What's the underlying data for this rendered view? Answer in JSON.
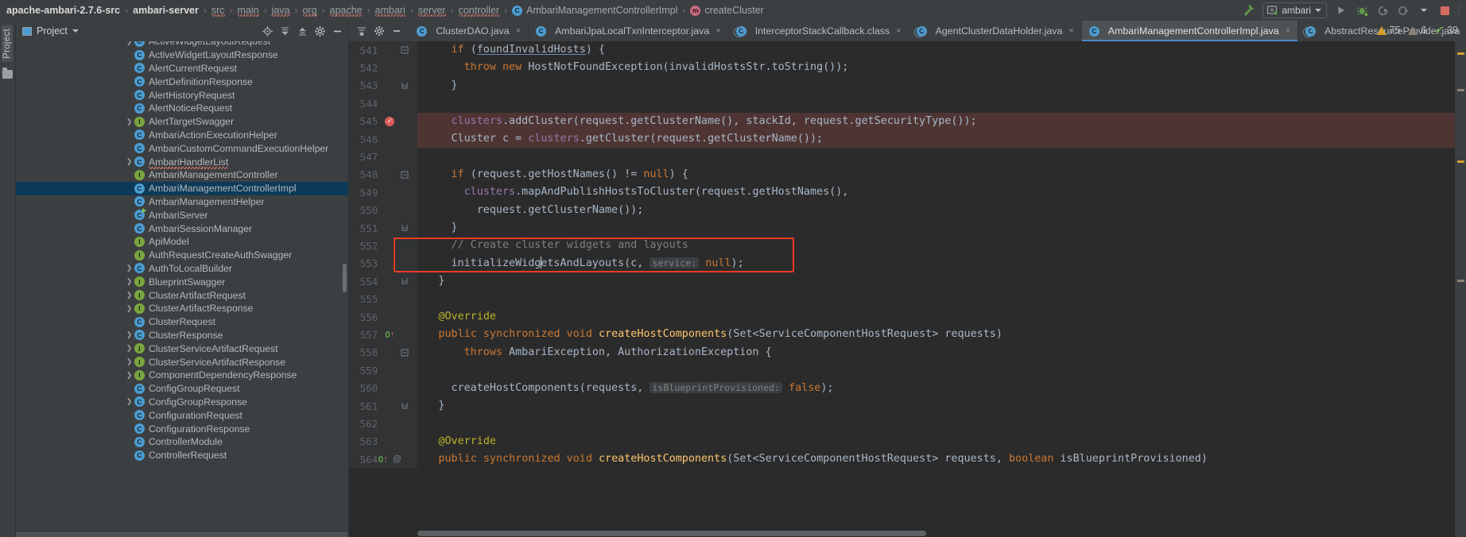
{
  "breadcrumb": {
    "items": [
      {
        "label": "apache-ambari-2.7.6-src",
        "style": "bold"
      },
      {
        "label": "ambari-server",
        "style": "bold"
      },
      {
        "label": "src",
        "style": "wavy"
      },
      {
        "label": "main",
        "style": "wavy"
      },
      {
        "label": "java",
        "style": "wavy"
      },
      {
        "label": "org",
        "style": "wavy"
      },
      {
        "label": "apache",
        "style": "wavy"
      },
      {
        "label": "ambari",
        "style": "wavy"
      },
      {
        "label": "server",
        "style": "wavy"
      },
      {
        "label": "controller",
        "style": "wavy"
      },
      {
        "label": "AmbariManagementControllerImpl",
        "style": "class"
      },
      {
        "label": "createCluster",
        "style": "method"
      }
    ],
    "separator": "›"
  },
  "toolbar": {
    "build_icon": "hammer-icon",
    "run_config": "ambari",
    "run_icon": "run-icon",
    "debug_icon": "debug-icon",
    "rerun_icon": "rerun-icon",
    "profile_icon": "profile-icon",
    "stop_icon": "stop-icon",
    "dropdown_caret": "▾"
  },
  "sidebar": {
    "vertical_tab": "Project",
    "title": "Project",
    "caret": "▾",
    "actions": [
      "locate-icon",
      "collapse-all-icon",
      "expand-icon",
      "settings-icon",
      "hide-icon"
    ],
    "tree": [
      {
        "label": "ActiveWidgetLayoutRequest",
        "icon": "class",
        "arrow": true,
        "partial": true
      },
      {
        "label": "ActiveWidgetLayoutResponse",
        "icon": "class",
        "arrow": false
      },
      {
        "label": "AlertCurrentRequest",
        "icon": "class",
        "arrow": false
      },
      {
        "label": "AlertDefinitionResponse",
        "icon": "class",
        "arrow": false
      },
      {
        "label": "AlertHistoryRequest",
        "icon": "class",
        "arrow": false
      },
      {
        "label": "AlertNoticeRequest",
        "icon": "class",
        "arrow": false
      },
      {
        "label": "AlertTargetSwagger",
        "icon": "interface",
        "arrow": true
      },
      {
        "label": "AmbariActionExecutionHelper",
        "icon": "class",
        "arrow": false
      },
      {
        "label": "AmbariCustomCommandExecutionHelper",
        "icon": "class",
        "arrow": false
      },
      {
        "label": "AmbariHandlerList",
        "icon": "class",
        "arrow": true,
        "wavy": true
      },
      {
        "label": "AmbariManagementController",
        "icon": "interface",
        "arrow": false
      },
      {
        "label": "AmbariManagementControllerImpl",
        "icon": "class",
        "arrow": false,
        "selected": true
      },
      {
        "label": "AmbariManagementHelper",
        "icon": "class",
        "arrow": false
      },
      {
        "label": "AmbariServer",
        "icon": "class",
        "arrow": false,
        "runnable": true
      },
      {
        "label": "AmbariSessionManager",
        "icon": "class",
        "arrow": false
      },
      {
        "label": "ApiModel",
        "icon": "interface",
        "arrow": false
      },
      {
        "label": "AuthRequestCreateAuthSwagger",
        "icon": "interface",
        "arrow": false
      },
      {
        "label": "AuthToLocalBuilder",
        "icon": "class",
        "arrow": true
      },
      {
        "label": "BlueprintSwagger",
        "icon": "interface",
        "arrow": true
      },
      {
        "label": "ClusterArtifactRequest",
        "icon": "interface",
        "arrow": true
      },
      {
        "label": "ClusterArtifactResponse",
        "icon": "interface",
        "arrow": true
      },
      {
        "label": "ClusterRequest",
        "icon": "class",
        "arrow": false
      },
      {
        "label": "ClusterResponse",
        "icon": "class",
        "arrow": true
      },
      {
        "label": "ClusterServiceArtifactRequest",
        "icon": "interface",
        "arrow": true
      },
      {
        "label": "ClusterServiceArtifactResponse",
        "icon": "interface",
        "arrow": true
      },
      {
        "label": "ComponentDependencyResponse",
        "icon": "interface",
        "arrow": true
      },
      {
        "label": "ConfigGroupRequest",
        "icon": "class",
        "arrow": false
      },
      {
        "label": "ConfigGroupResponse",
        "icon": "class",
        "arrow": true
      },
      {
        "label": "ConfigurationRequest",
        "icon": "class",
        "arrow": false
      },
      {
        "label": "ConfigurationResponse",
        "icon": "class",
        "arrow": false
      },
      {
        "label": "ControllerModule",
        "icon": "class",
        "arrow": false
      },
      {
        "label": "ControllerRequest",
        "icon": "class",
        "arrow": false,
        "partial": true
      }
    ]
  },
  "editor_tabs": {
    "controls": [
      "sort-icon",
      "settings-icon",
      "minimize-icon"
    ],
    "tabs": [
      {
        "label": "ClusterDAO.java",
        "icon": "class",
        "active": false,
        "close": "×"
      },
      {
        "label": "AmbariJpaLocalTxnInterceptor.java",
        "icon": "class",
        "active": false,
        "close": "×"
      },
      {
        "label": "InterceptorStackCallback.class",
        "icon": "class-decompiled",
        "active": false,
        "close": "×"
      },
      {
        "label": "AgentClusterDataHolder.java",
        "icon": "class-decompiled",
        "active": false,
        "close": "×"
      },
      {
        "label": "AmbariManagementControllerImpl.java",
        "icon": "class",
        "active": true,
        "close": "×"
      },
      {
        "label": "AbstractResourceProvider.java",
        "icon": "class-decompiled",
        "active": false,
        "close": ""
      }
    ]
  },
  "inspections": {
    "warnings": "75",
    "weak_warnings": "6",
    "checks": "39"
  },
  "code": {
    "lines": [
      {
        "num": "541",
        "fold": "minus",
        "highlight": "none",
        "indent": 4,
        "tokens": [
          {
            "t": "if ",
            "c": "kw"
          },
          {
            "t": "(",
            "c": ""
          },
          {
            "t": "foundInvalidHosts",
            "c": "err"
          },
          {
            "t": ") {",
            "c": ""
          }
        ]
      },
      {
        "num": "542",
        "fold": "",
        "highlight": "none",
        "indent": 6,
        "tokens": [
          {
            "t": "throw ",
            "c": "kw"
          },
          {
            "t": "new ",
            "c": "kw"
          },
          {
            "t": "HostNotFoundException(invalidHostsStr.toString());",
            "c": ""
          }
        ]
      },
      {
        "num": "543",
        "fold": "end",
        "highlight": "none",
        "indent": 4,
        "tokens": [
          {
            "t": "}",
            "c": ""
          }
        ]
      },
      {
        "num": "544",
        "fold": "",
        "highlight": "none",
        "indent": 0,
        "tokens": []
      },
      {
        "num": "545",
        "fold": "",
        "highlight": "red",
        "gutter": "breakpoint",
        "indent": 4,
        "tokens": [
          {
            "t": "clusters",
            "c": "field"
          },
          {
            "t": ".addCluster(request.getClusterName(), stackId, request.getSecurityType());",
            "c": ""
          }
        ]
      },
      {
        "num": "546",
        "fold": "",
        "highlight": "red",
        "indent": 4,
        "tokens": [
          {
            "t": "Cluster c = ",
            "c": ""
          },
          {
            "t": "clusters",
            "c": "field"
          },
          {
            "t": ".getCluster(request.getClusterName());",
            "c": ""
          }
        ]
      },
      {
        "num": "547",
        "fold": "",
        "highlight": "none",
        "indent": 0,
        "tokens": []
      },
      {
        "num": "548",
        "fold": "minus",
        "highlight": "none",
        "indent": 4,
        "tokens": [
          {
            "t": "if ",
            "c": "kw"
          },
          {
            "t": "(request.getHostNames() != ",
            "c": ""
          },
          {
            "t": "null",
            "c": "kw"
          },
          {
            "t": ") {",
            "c": ""
          }
        ]
      },
      {
        "num": "549",
        "fold": "",
        "highlight": "none",
        "indent": 6,
        "tokens": [
          {
            "t": "clusters",
            "c": "field"
          },
          {
            "t": ".mapAndPublishHostsToCluster(request.getHostNames(),",
            "c": ""
          }
        ]
      },
      {
        "num": "550",
        "fold": "",
        "highlight": "none",
        "indent": 8,
        "tokens": [
          {
            "t": "request.getClusterName());",
            "c": ""
          }
        ]
      },
      {
        "num": "551",
        "fold": "end",
        "highlight": "none",
        "indent": 4,
        "tokens": [
          {
            "t": "}",
            "c": ""
          }
        ]
      },
      {
        "num": "552",
        "fold": "",
        "highlight": "none",
        "indent": 4,
        "tokens": [
          {
            "t": "// Create cluster widgets and layouts",
            "c": "cmt"
          }
        ]
      },
      {
        "num": "553",
        "fold": "",
        "highlight": "none",
        "indent": 4,
        "caret_after": "initializeWidg",
        "tokens": [
          {
            "t": "initializeWidgetsAndLayouts(c, ",
            "c": ""
          },
          {
            "t": "service:",
            "c": "hint"
          },
          {
            "t": " ",
            "c": ""
          },
          {
            "t": "null",
            "c": "kw"
          },
          {
            "t": ");",
            "c": ""
          }
        ]
      },
      {
        "num": "554",
        "fold": "end",
        "highlight": "none",
        "indent": 2,
        "tokens": [
          {
            "t": "}",
            "c": ""
          }
        ]
      },
      {
        "num": "555",
        "fold": "",
        "highlight": "none",
        "indent": 0,
        "tokens": []
      },
      {
        "num": "556",
        "fold": "",
        "highlight": "none",
        "indent": 2,
        "tokens": [
          {
            "t": "@Override",
            "c": "ann"
          }
        ]
      },
      {
        "num": "557",
        "fold": "",
        "highlight": "none",
        "gutter": "override-impl",
        "indent": 2,
        "tokens": [
          {
            "t": "public ",
            "c": "kw"
          },
          {
            "t": "synchronized ",
            "c": "kw"
          },
          {
            "t": "void ",
            "c": "kw"
          },
          {
            "t": "createHostComponents",
            "c": "fn"
          },
          {
            "t": "(Set<ServiceComponentHostRequest> requests)",
            "c": ""
          }
        ]
      },
      {
        "num": "558",
        "fold": "minus",
        "highlight": "none",
        "indent": 6,
        "tokens": [
          {
            "t": "throws ",
            "c": "kw"
          },
          {
            "t": "AmbariException, AuthorizationException {",
            "c": ""
          }
        ]
      },
      {
        "num": "559",
        "fold": "",
        "highlight": "none",
        "indent": 0,
        "tokens": []
      },
      {
        "num": "560",
        "fold": "",
        "highlight": "none",
        "indent": 4,
        "tokens": [
          {
            "t": "createHostComponents(requests, ",
            "c": ""
          },
          {
            "t": "isBlueprintProvisioned:",
            "c": "hint"
          },
          {
            "t": " ",
            "c": ""
          },
          {
            "t": "false",
            "c": "kw"
          },
          {
            "t": ");",
            "c": ""
          }
        ]
      },
      {
        "num": "561",
        "fold": "end",
        "highlight": "none",
        "indent": 2,
        "tokens": [
          {
            "t": "}",
            "c": ""
          }
        ]
      },
      {
        "num": "562",
        "fold": "",
        "highlight": "none",
        "indent": 0,
        "tokens": []
      },
      {
        "num": "563",
        "fold": "",
        "highlight": "none",
        "indent": 2,
        "tokens": [
          {
            "t": "@Override",
            "c": "ann"
          }
        ]
      },
      {
        "num": "564",
        "fold": "",
        "highlight": "none",
        "gutter": "override-impl-at",
        "indent": 2,
        "tokens": [
          {
            "t": "public ",
            "c": "kw"
          },
          {
            "t": "synchronized ",
            "c": "kw"
          },
          {
            "t": "void ",
            "c": "kw"
          },
          {
            "t": "createHostComponents",
            "c": "fn"
          },
          {
            "t": "(Set<ServiceComponentHostRequest> requests, ",
            "c": ""
          },
          {
            "t": "boolean ",
            "c": "kw"
          },
          {
            "t": "isBlueprintProvisioned)",
            "c": ""
          }
        ]
      }
    ],
    "annotation_box": {
      "label": "red-highlight-rectangle",
      "start_line": "552",
      "end_line": "553"
    }
  }
}
